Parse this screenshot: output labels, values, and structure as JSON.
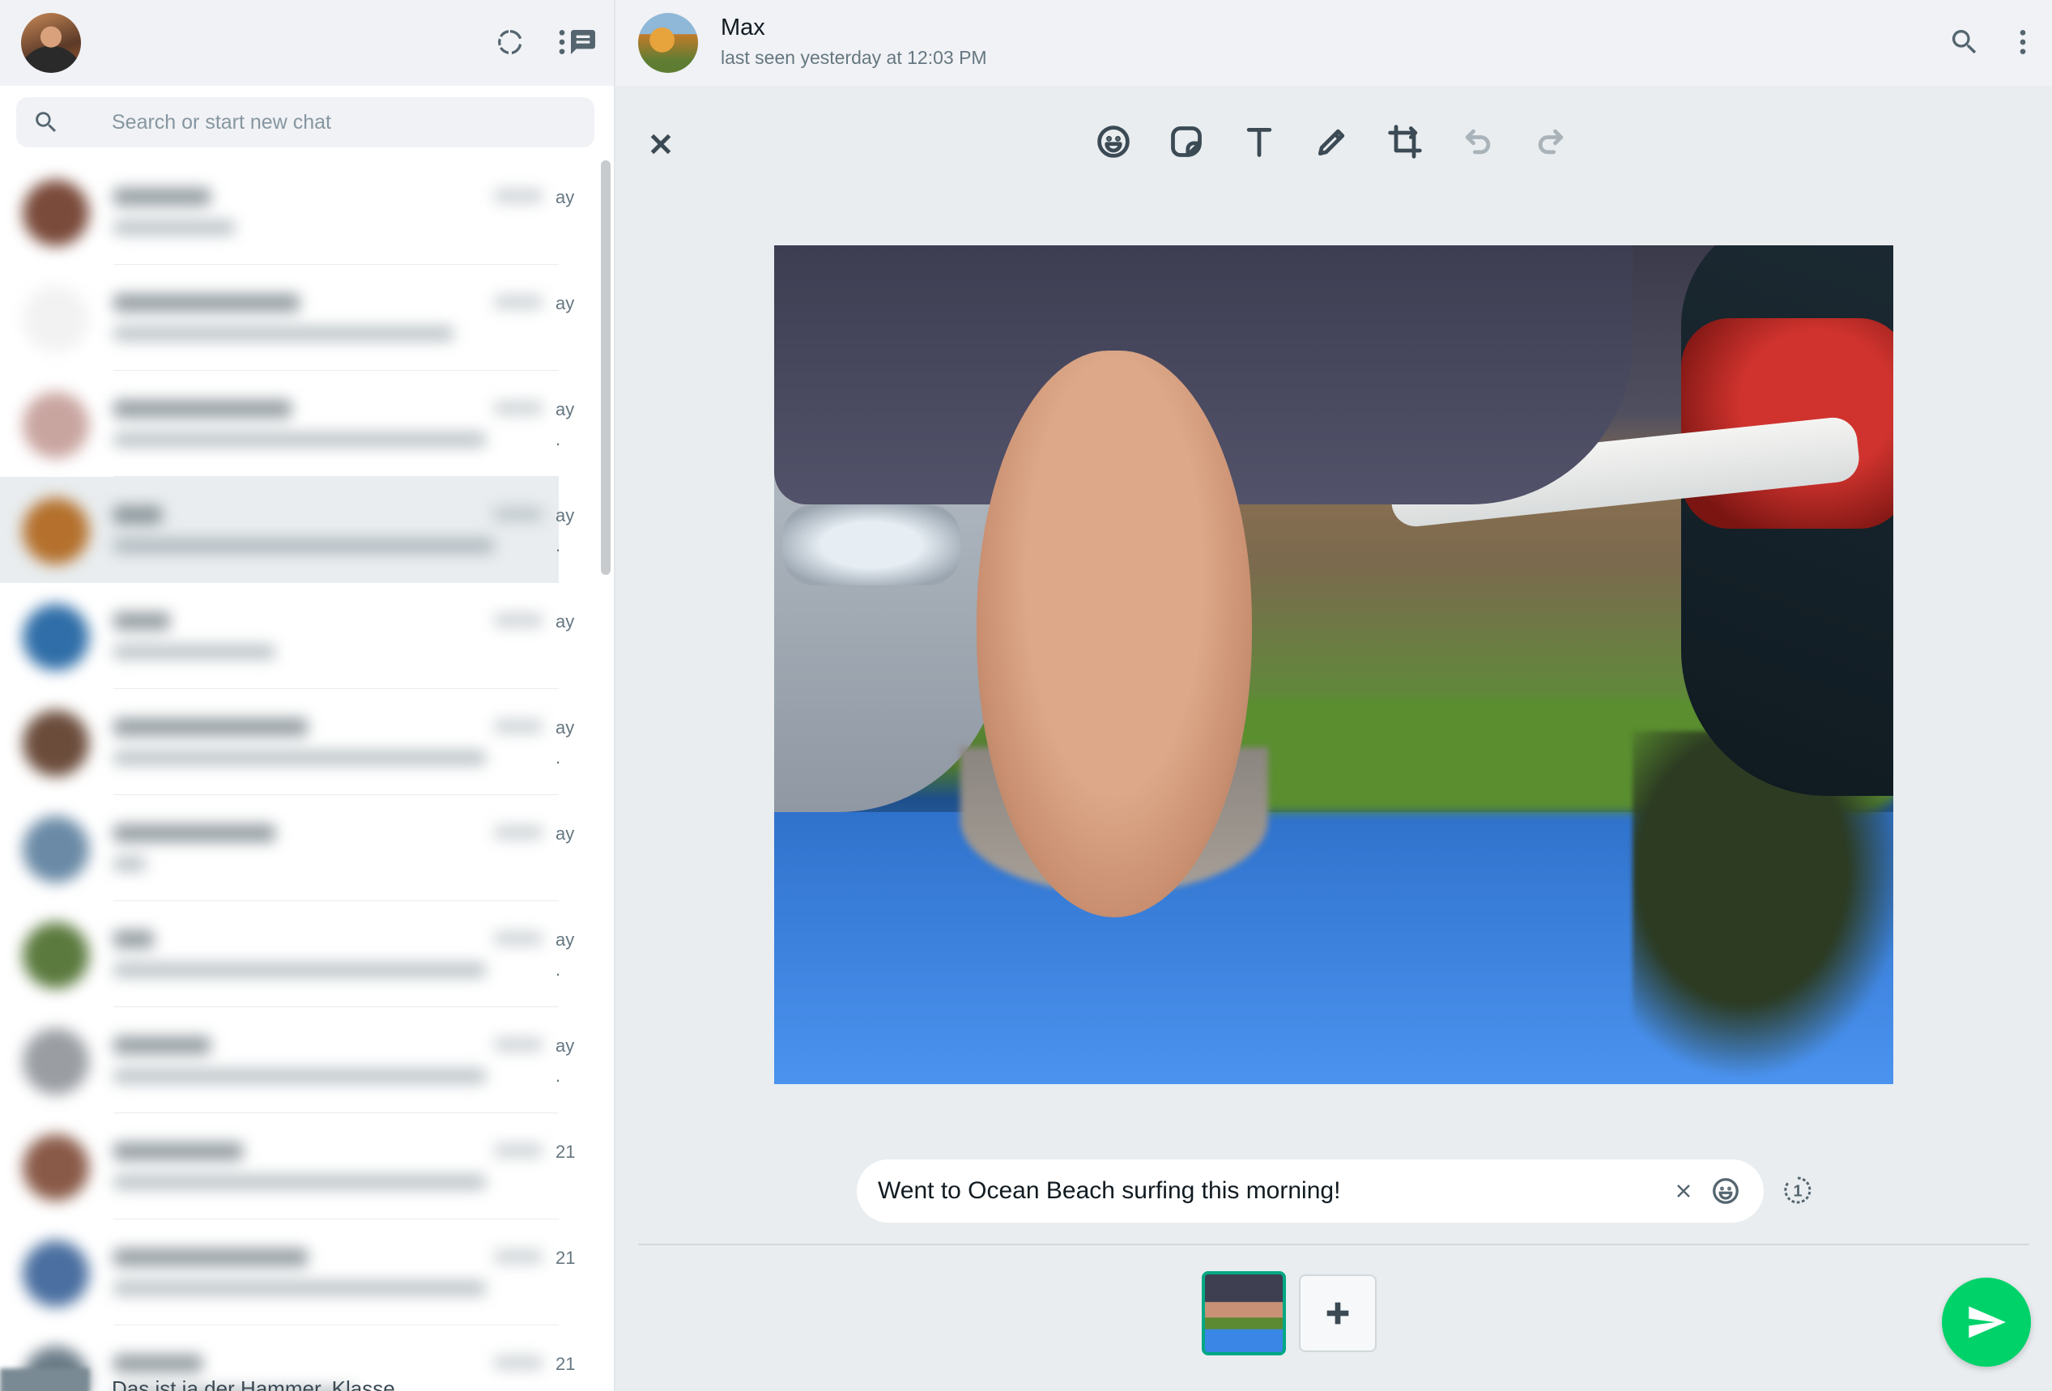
{
  "left_pane": {
    "search": {
      "placeholder": "Search or start new chat"
    },
    "chats": [
      {
        "time": "ay",
        "has_more": false,
        "avatar_color": "#7a4a3a",
        "selected": false
      },
      {
        "time": "ay",
        "has_more": false,
        "avatar_color": "#f2f2f2",
        "selected": false
      },
      {
        "time": "ay",
        "has_more": true,
        "avatar_color": "#c9a5a0",
        "selected": false
      },
      {
        "time": "ay",
        "has_more": true,
        "avatar_color": "#b4702c",
        "selected": true
      },
      {
        "time": "ay",
        "has_more": false,
        "avatar_color": "#2f6ea8",
        "selected": false
      },
      {
        "time": "ay",
        "has_more": true,
        "avatar_color": "#6b4c3b",
        "selected": false
      },
      {
        "time": "ay",
        "has_more": false,
        "avatar_color": "#6a8aa6",
        "selected": false
      },
      {
        "time": "ay",
        "has_more": true,
        "avatar_color": "#5b7a3e",
        "selected": false
      },
      {
        "time": "ay",
        "has_more": true,
        "avatar_color": "#9a9ea3",
        "selected": false
      },
      {
        "time": "21",
        "has_more": false,
        "avatar_color": "#8a5a48",
        "selected": false
      },
      {
        "time": "21",
        "has_more": false,
        "avatar_color": "#4a6fa0",
        "selected": false
      },
      {
        "time": "21",
        "has_more": false,
        "avatar_color": "#6b7c88",
        "selected": false
      }
    ],
    "partial_message": "Das ist ja der Hammer, Klasse"
  },
  "chat_header": {
    "name": "Max",
    "status": "last seen yesterday at 12:03 PM"
  },
  "editor": {
    "tools": [
      "emoji-icon",
      "sticker-icon",
      "text-icon",
      "pencil-icon",
      "crop-icon",
      "undo-icon",
      "redo-icon"
    ],
    "caption": {
      "value": "Went to Ocean Beach surfing this morning!"
    },
    "view_once_label": "1"
  },
  "colors": {
    "accent": "#00a884",
    "send": "#00d26a",
    "header_bg": "#f0f2f5",
    "editor_bg": "#e9edef"
  }
}
